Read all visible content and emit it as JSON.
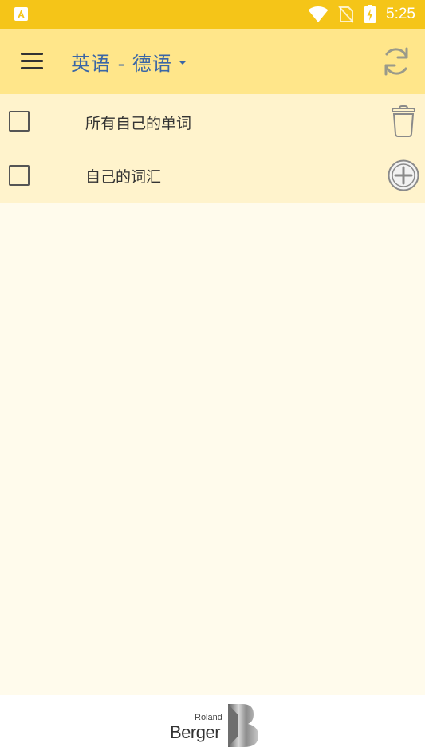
{
  "status_bar": {
    "time": "5:25",
    "icons": [
      "app-notification-icon",
      "wifi-icon",
      "no-sim-icon",
      "battery-charging-icon"
    ]
  },
  "app_bar": {
    "menu_icon": "hamburger-menu-icon",
    "title": "英语 - 德语",
    "sync_icon": "sync-icon"
  },
  "list": {
    "items": [
      {
        "label": "所有自己的单词",
        "checked": false,
        "action_icon": "trash-icon"
      },
      {
        "label": "自己的词汇",
        "checked": false,
        "action_icon": "add-circle-icon"
      }
    ]
  },
  "footer": {
    "logo_small": "Roland",
    "logo_large": "Berger"
  },
  "colors": {
    "status_bar": "#f5c518",
    "app_bar": "#ffe68a",
    "list_bg": "#fff3cc",
    "page_bg": "#fffbec",
    "title_text": "#3a66a6"
  }
}
